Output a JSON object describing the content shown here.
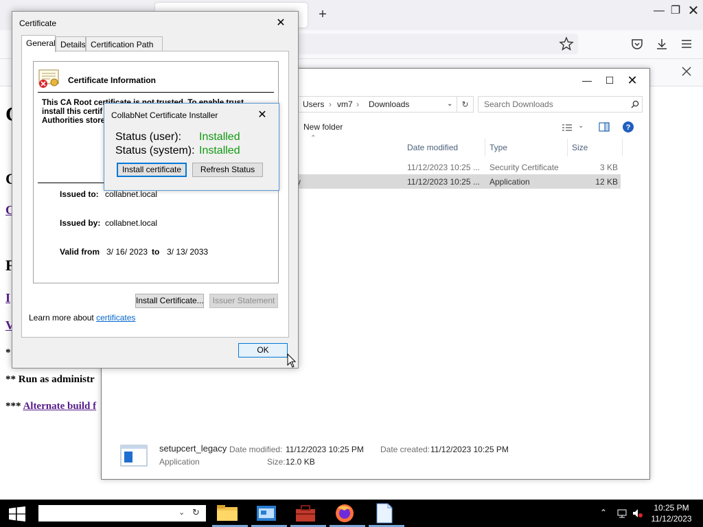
{
  "browser": {
    "page_fragments": {
      "run_as_admin": "** Run as administr",
      "alternate_prefix": "***",
      "alternate_link": "Alternate build f",
      "single_star": "*"
    }
  },
  "explorer": {
    "address": [
      "Users",
      "vm7",
      "Downloads"
    ],
    "search_placeholder": "Search Downloads",
    "new_folder": "New folder",
    "columns": [
      "Date modified",
      "Type",
      "Size"
    ],
    "rows": [
      {
        "name_fragment": "",
        "date": "11/12/2023 10:25 ...",
        "type": "Security Certificate",
        "size": "3 KB"
      },
      {
        "name_fragment": "y",
        "date": "11/12/2023 10:25 ...",
        "type": "Application",
        "size": "12 KB"
      }
    ],
    "details": {
      "filename": "setupcert_legacy",
      "filetype": "Application",
      "modified_label": "Date modified:",
      "modified_value": "11/12/2023 10:25 PM",
      "created_label": "Date created:",
      "created_value": "11/12/2023 10:25 PM",
      "size_label": "Size:",
      "size_value": "12.0 KB"
    }
  },
  "cert": {
    "title": "Certificate",
    "tabs": [
      "General",
      "Details",
      "Certification Path"
    ],
    "info_title": "Certificate Information",
    "warning": [
      "This CA Root certificate is not trusted. To enable trust,",
      "install this certif",
      "Authorities store."
    ],
    "issued_to_label": "Issued to:",
    "issued_to": "collabnet.local",
    "issued_by_label": "Issued by:",
    "issued_by": "collabnet.local",
    "valid_from_label": "Valid from",
    "valid_from": "3/ 16/ 2023",
    "valid_to_label": "to",
    "valid_to": "3/ 13/ 2033",
    "install_button": "Install Certificate...",
    "issuer_button": "Issuer Statement",
    "learn_prefix": "Learn more about",
    "learn_link": "certificates",
    "ok_button": "OK"
  },
  "installer": {
    "title": "CollabNet Certificate Installer",
    "status_user_label": "Status (user):",
    "status_user": "Installed",
    "status_system_label": "Status (system):",
    "status_system": "Installed",
    "install_button": "Install certificate",
    "refresh_button": "Refresh Status"
  },
  "taskbar": {
    "time": "10:25 PM",
    "date": "11/12/2023"
  },
  "colors": {
    "installed_green": "#119911",
    "link_purple": "#551a8b",
    "selection_gray": "#d9d9d9"
  }
}
